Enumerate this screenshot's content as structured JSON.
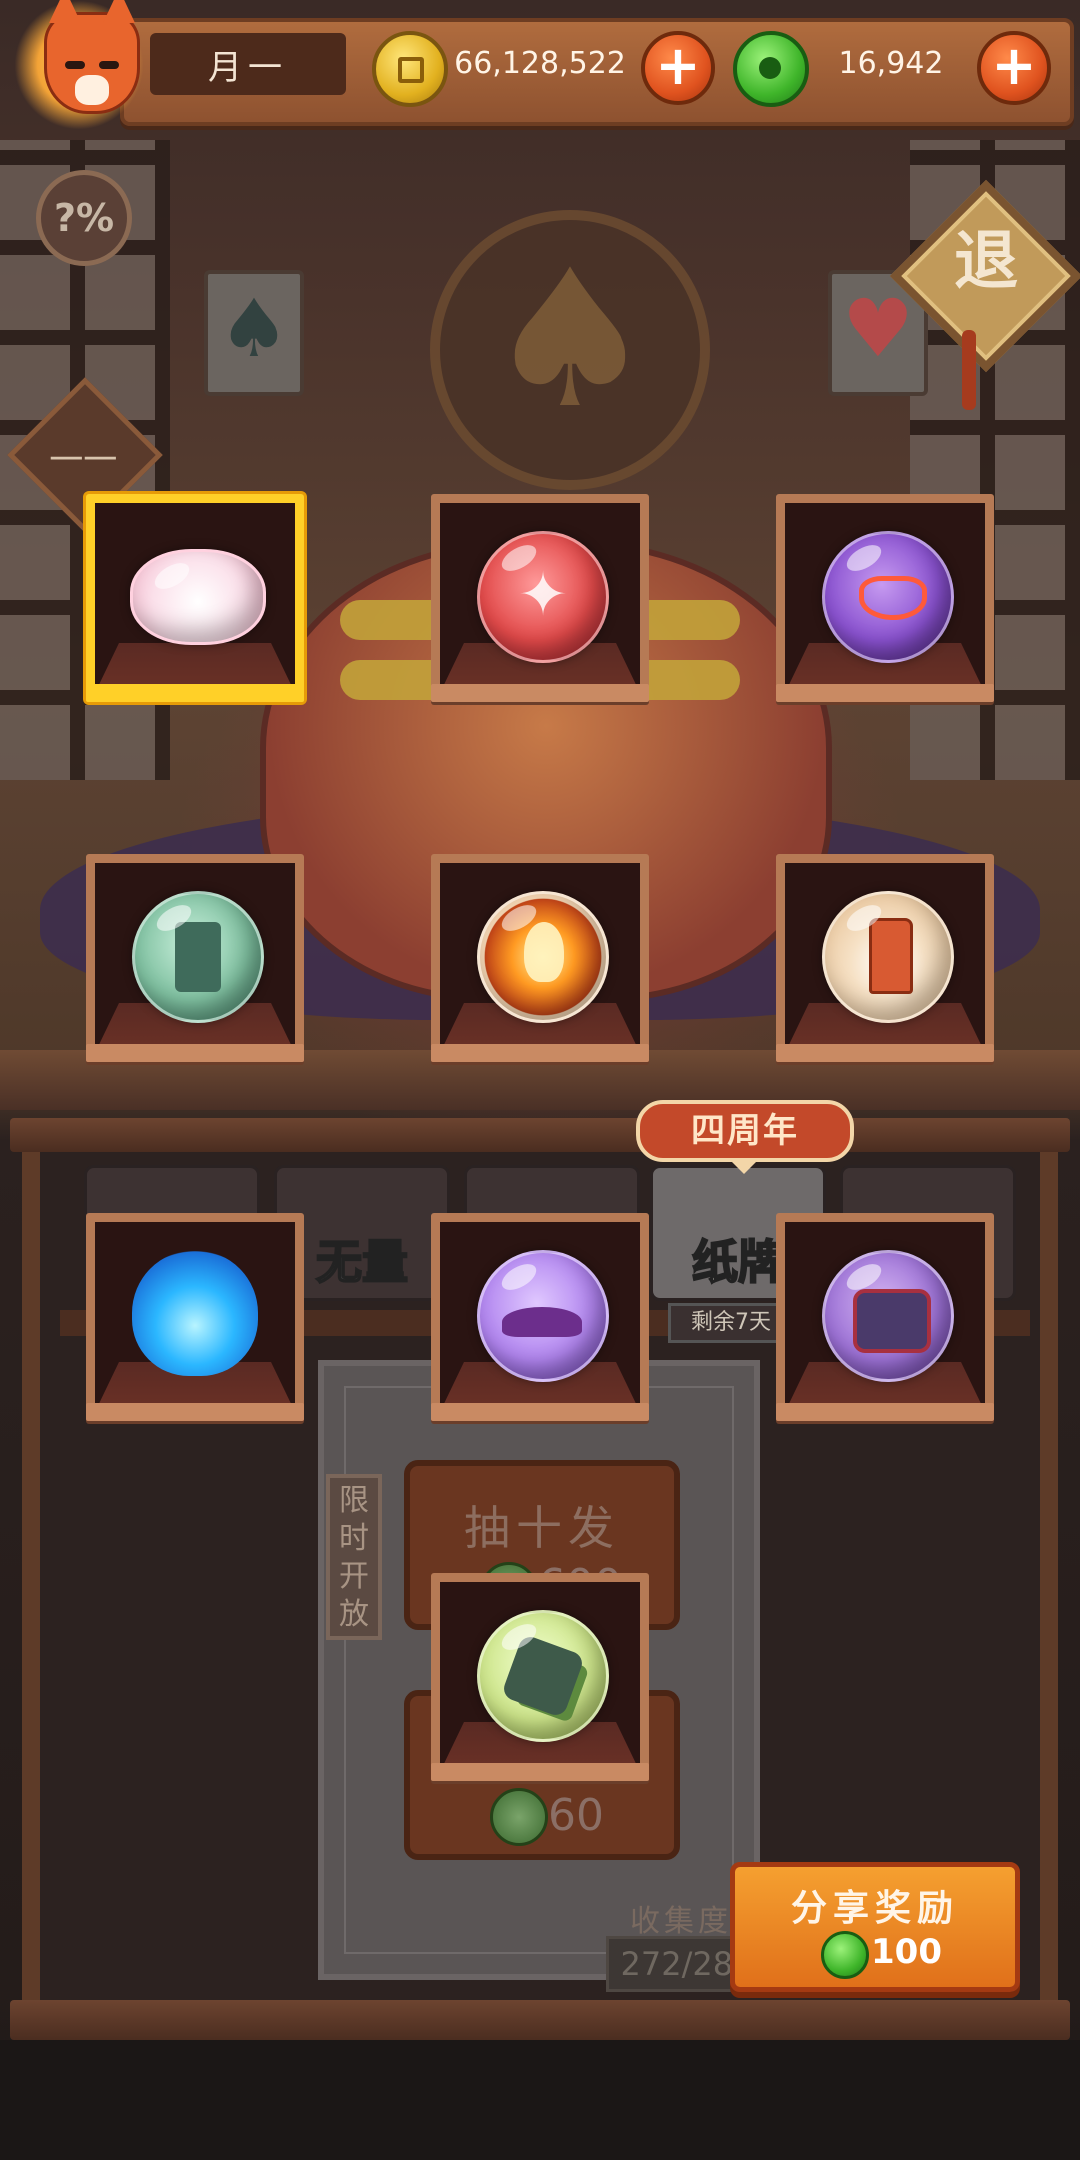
{
  "header": {
    "player_name": "月一",
    "gold_amount": "66,128,522",
    "jade_amount": "16,942",
    "add_gold_label": "+",
    "add_jade_label": "+"
  },
  "side": {
    "odds_label": "?%",
    "menu_label": "一一",
    "exit_label": "退"
  },
  "items": [
    {
      "icon": "pink-cloud-icon",
      "selected": true
    },
    {
      "icon": "red-wing-orb-icon",
      "selected": false
    },
    {
      "icon": "purple-mask-orb-icon",
      "selected": false
    },
    {
      "icon": "jade-totem-orb-icon",
      "selected": false
    },
    {
      "icon": "fire-orb-icon",
      "selected": false
    },
    {
      "icon": "lantern-orb-icon",
      "selected": false
    },
    {
      "icon": "blue-flame-icon",
      "selected": false
    },
    {
      "icon": "purple-cloth-orb-icon",
      "selected": false
    },
    {
      "icon": "demon-helmet-orb-icon",
      "selected": false
    },
    {
      "icon": "vine-rock-orb-icon",
      "selected": false
    }
  ],
  "tabs": [
    {
      "label": "",
      "active": false
    },
    {
      "label": "无量",
      "active": false
    },
    {
      "label": "",
      "active": false
    },
    {
      "label": "纸牌",
      "active": true
    },
    {
      "label": "",
      "active": false
    }
  ],
  "event": {
    "badge": "四周年",
    "remaining": "剩余7天",
    "limited_tag": "限时开放"
  },
  "draw": {
    "ten_title": "抽十发",
    "ten_cost": "600",
    "one_cost": "60"
  },
  "collection": {
    "label": "收集度",
    "value": "272/282"
  },
  "share": {
    "title": "分享奖励",
    "reward": "100"
  },
  "colors": {
    "selected_frame": "#ffd028",
    "frame": "#b67a55",
    "share_button": "#f5a030",
    "jade_coin": "#3fb52a",
    "gold_coin": "#e2b11f"
  }
}
